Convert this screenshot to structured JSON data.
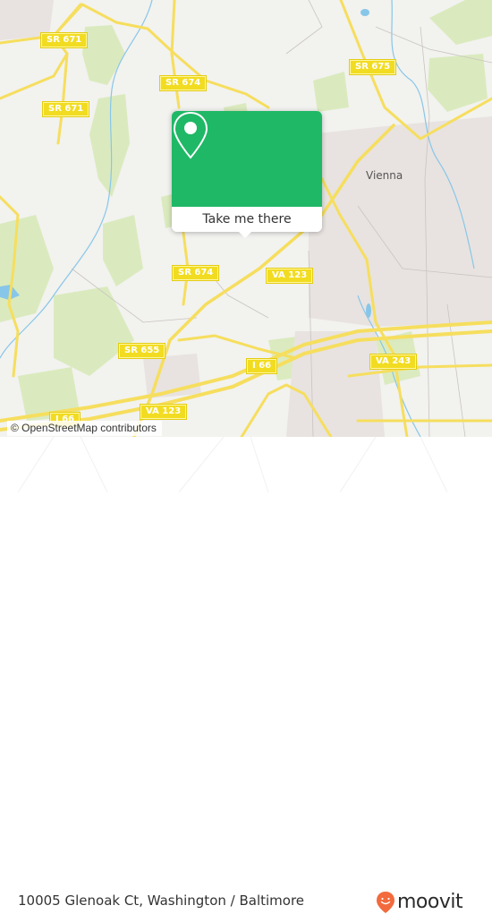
{
  "map": {
    "colors": {
      "background": "#f2f2ef",
      "park": "#d8eab9",
      "urban": "#e8e3e0",
      "road": "#f6de5e",
      "water": "#88c6e9",
      "accent": "#1fb866",
      "brand": "#f26a3d"
    },
    "road_labels": [
      {
        "id": "sr671-a",
        "text": "SR 671"
      },
      {
        "id": "sr671-b",
        "text": "SR 671"
      },
      {
        "id": "sr674-a",
        "text": "SR 674"
      },
      {
        "id": "sr674-b",
        "text": "SR 674"
      },
      {
        "id": "sr675",
        "text": "SR 675"
      },
      {
        "id": "va123-a",
        "text": "VA 123"
      },
      {
        "id": "va123-b",
        "text": "VA 123"
      },
      {
        "id": "sr655",
        "text": "SR 655"
      },
      {
        "id": "i66-a",
        "text": "I 66"
      },
      {
        "id": "i66-b",
        "text": "I 66"
      },
      {
        "id": "va243",
        "text": "VA 243"
      }
    ],
    "place_labels": [
      {
        "id": "vienna",
        "text": "Vienna"
      }
    ],
    "attribution": "© OpenStreetMap contributors"
  },
  "popup": {
    "icon": "map-pin-icon",
    "button_label": "Take me there"
  },
  "footer": {
    "address": "10005 Glenoak Ct, Washington / Baltimore",
    "brand": "moovit",
    "brand_icon": "moovit-smile-pin-icon"
  }
}
